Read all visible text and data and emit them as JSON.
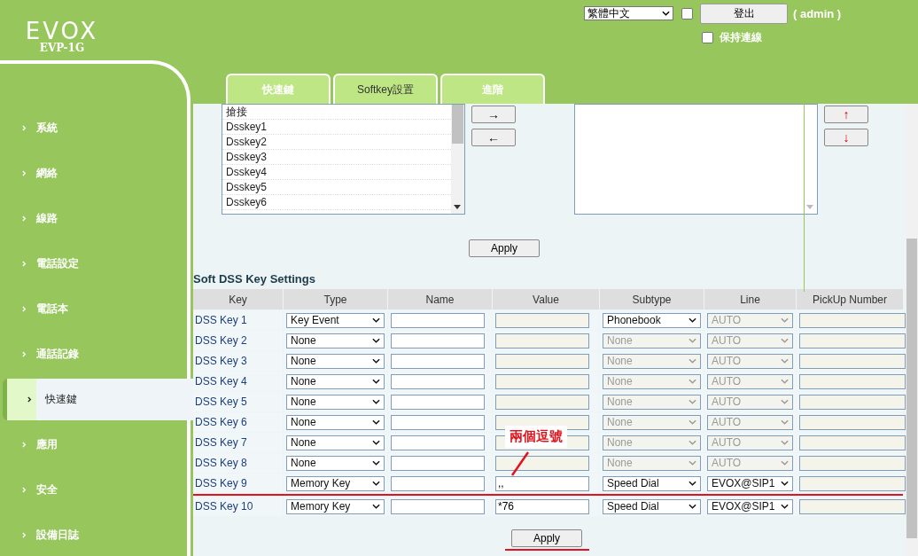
{
  "header": {
    "logo": "EVOX",
    "model": "EVP-1G",
    "language": "繁體中文",
    "remember_checkbox": {
      "checked": false
    },
    "logout_button": "登出",
    "user": "( admin )",
    "keep_login": {
      "label": "保持連線",
      "checked": false
    }
  },
  "tabs": [
    {
      "label": "快速鍵",
      "selected": false
    },
    {
      "label": "Softkey設置",
      "selected": true
    },
    {
      "label": "進階",
      "selected": false
    }
  ],
  "sidebar": {
    "items": [
      {
        "label": "系統",
        "selected": false
      },
      {
        "label": "網絡",
        "selected": false
      },
      {
        "label": "線路",
        "selected": false
      },
      {
        "label": "電話設定",
        "selected": false
      },
      {
        "label": "電話本",
        "selected": false
      },
      {
        "label": "通話記錄",
        "selected": false
      },
      {
        "label": "快速鍵",
        "selected": true
      },
      {
        "label": "應用",
        "selected": false
      },
      {
        "label": "安全",
        "selected": false
      },
      {
        "label": "設備日誌",
        "selected": false
      }
    ]
  },
  "softkey": {
    "available": [
      "搶接",
      "Dsskey1",
      "Dsskey2",
      "Dsskey3",
      "Dsskey4",
      "Dsskey5",
      "Dsskey6"
    ],
    "move_buttons": [
      "→",
      "←"
    ],
    "order_buttons": [
      "↑",
      "↓"
    ],
    "apply": "Apply"
  },
  "dss_settings": {
    "title": "Soft DSS Key Settings",
    "columns": [
      "Key",
      "Type",
      "Name",
      "Value",
      "Subtype",
      "Line",
      "PickUp Number"
    ],
    "rows": [
      {
        "key": "DSS Key 1",
        "type": "Key Event",
        "value": "",
        "value_disabled": true,
        "subtype": "Phonebook",
        "subtype_disabled": false,
        "line": "AUTO",
        "line_disabled": true
      },
      {
        "key": "DSS Key 2",
        "type": "None",
        "value": "",
        "value_disabled": true,
        "subtype": "None",
        "subtype_disabled": true,
        "line": "AUTO",
        "line_disabled": true
      },
      {
        "key": "DSS Key 3",
        "type": "None",
        "value": "",
        "value_disabled": true,
        "subtype": "None",
        "subtype_disabled": true,
        "line": "AUTO",
        "line_disabled": true
      },
      {
        "key": "DSS Key 4",
        "type": "None",
        "value": "",
        "value_disabled": true,
        "subtype": "None",
        "subtype_disabled": true,
        "line": "AUTO",
        "line_disabled": true
      },
      {
        "key": "DSS Key 5",
        "type": "None",
        "value": "",
        "value_disabled": true,
        "subtype": "None",
        "subtype_disabled": true,
        "line": "AUTO",
        "line_disabled": true
      },
      {
        "key": "DSS Key 6",
        "type": "None",
        "value": "",
        "value_disabled": true,
        "subtype": "None",
        "subtype_disabled": true,
        "line": "AUTO",
        "line_disabled": true
      },
      {
        "key": "DSS Key 7",
        "type": "None",
        "value": "",
        "value_disabled": true,
        "subtype": "None",
        "subtype_disabled": true,
        "line": "AUTO",
        "line_disabled": true
      },
      {
        "key": "DSS Key 8",
        "type": "None",
        "value": "",
        "value_disabled": true,
        "subtype": "None",
        "subtype_disabled": true,
        "line": "AUTO",
        "line_disabled": true
      },
      {
        "key": "DSS Key 9",
        "type": "Memory Key",
        "value": ",,",
        "value_disabled": false,
        "subtype": "Speed Dial",
        "subtype_disabled": false,
        "line": "EVOX@SIP1",
        "line_disabled": false,
        "underlined": true
      },
      {
        "key": "DSS Key 10",
        "type": "Memory Key",
        "value": "*76",
        "value_disabled": false,
        "subtype": "Speed Dial",
        "subtype_disabled": false,
        "line": "EVOX@SIP1",
        "line_disabled": false,
        "underlined": false
      }
    ],
    "apply": "Apply"
  },
  "annotation": {
    "text": "兩個逗號"
  }
}
